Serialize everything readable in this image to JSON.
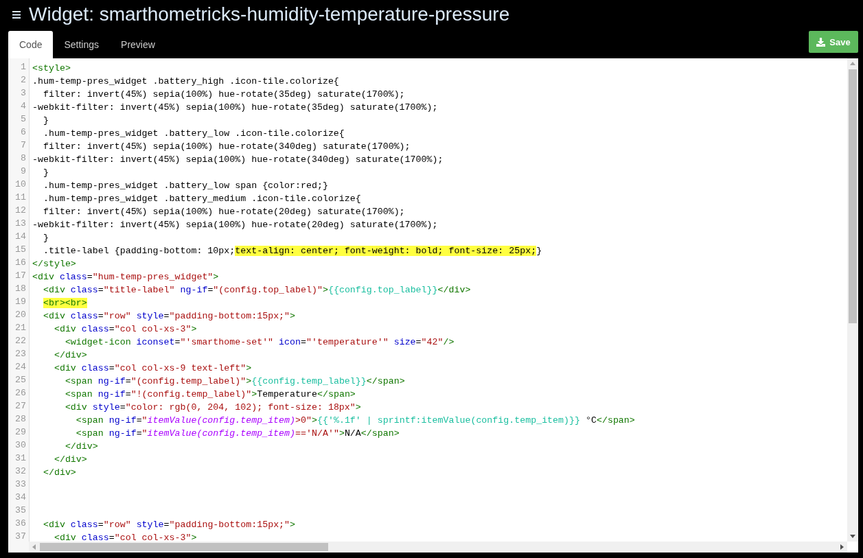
{
  "header": {
    "title": "Widget: smarthometricks-humidity-temperature-pressure"
  },
  "tabs": [
    {
      "label": "Code",
      "selected": true
    },
    {
      "label": "Settings",
      "selected": false
    },
    {
      "label": "Preview",
      "selected": false
    }
  ],
  "save_button": {
    "label": "Save"
  },
  "editor": {
    "lines": [
      {
        "number": "1",
        "tokens": [
          {
            "kind": "tag",
            "text": "<style>"
          }
        ]
      },
      {
        "number": "2",
        "tokens": [
          {
            "kind": "text",
            "text": ".hum-temp-pres_widget .battery_high .icon-tile.colorize{"
          }
        ]
      },
      {
        "number": "3",
        "tokens": [
          {
            "kind": "text",
            "text": "  filter: invert(45%) sepia(100%) hue-rotate(35deg) saturate(1700%);"
          }
        ]
      },
      {
        "number": "4",
        "tokens": [
          {
            "kind": "text",
            "text": "-webkit-filter: invert(45%) sepia(100%) hue-rotate(35deg) saturate(1700%);"
          }
        ]
      },
      {
        "number": "5",
        "tokens": [
          {
            "kind": "text",
            "text": "  }"
          }
        ]
      },
      {
        "number": "6",
        "tokens": [
          {
            "kind": "text",
            "text": "  .hum-temp-pres_widget .battery_low .icon-tile.colorize{"
          }
        ]
      },
      {
        "number": "7",
        "tokens": [
          {
            "kind": "text",
            "text": "  filter: invert(45%) sepia(100%) hue-rotate(340deg) saturate(1700%);"
          }
        ]
      },
      {
        "number": "8",
        "tokens": [
          {
            "kind": "text",
            "text": "-webkit-filter: invert(45%) sepia(100%) hue-rotate(340deg) saturate(1700%);"
          }
        ]
      },
      {
        "number": "9",
        "tokens": [
          {
            "kind": "text",
            "text": "  }"
          }
        ]
      },
      {
        "number": "10",
        "tokens": [
          {
            "kind": "text",
            "text": "  .hum-temp-pres_widget .battery_low span {color:red;}"
          }
        ]
      },
      {
        "number": "11",
        "tokens": [
          {
            "kind": "text",
            "text": "  .hum-temp-pres_widget .battery_medium .icon-tile.colorize{"
          }
        ]
      },
      {
        "number": "12",
        "tokens": [
          {
            "kind": "text",
            "text": "  filter: invert(45%) sepia(100%) hue-rotate(20deg) saturate(1700%);"
          }
        ]
      },
      {
        "number": "13",
        "tokens": [
          {
            "kind": "text",
            "text": "-webkit-filter: invert(45%) sepia(100%) hue-rotate(20deg) saturate(1700%);"
          }
        ]
      },
      {
        "number": "14",
        "tokens": [
          {
            "kind": "text",
            "text": "  }"
          }
        ]
      },
      {
        "number": "15",
        "tokens": [
          {
            "kind": "text",
            "text": "  .title-label {padding-bottom: 10px;"
          },
          {
            "kind": "highlight",
            "text": "text-align: center; font-weight: bold; font-size: 25px;"
          },
          {
            "kind": "text",
            "text": "}"
          }
        ]
      },
      {
        "number": "16",
        "tokens": [
          {
            "kind": "tag",
            "text": "</style>"
          }
        ]
      },
      {
        "number": "17",
        "tokens": [
          {
            "kind": "tag",
            "text": "<div "
          },
          {
            "kind": "attr",
            "text": "class"
          },
          {
            "kind": "text",
            "text": "="
          },
          {
            "kind": "string",
            "text": "\"hum-temp-pres_widget\""
          },
          {
            "kind": "tag",
            "text": ">"
          }
        ]
      },
      {
        "number": "18",
        "tokens": [
          {
            "kind": "tag",
            "text": "  <div "
          },
          {
            "kind": "attr",
            "text": "class"
          },
          {
            "kind": "text",
            "text": "="
          },
          {
            "kind": "string",
            "text": "\"title-label\" "
          },
          {
            "kind": "attr",
            "text": "ng-if"
          },
          {
            "kind": "text",
            "text": "="
          },
          {
            "kind": "string",
            "text": "\"(config.top_label)\""
          },
          {
            "kind": "tag",
            "text": ">"
          },
          {
            "kind": "expr",
            "text": "{{config.top_label}}"
          },
          {
            "kind": "tag",
            "text": "</div>"
          }
        ]
      },
      {
        "number": "19",
        "tokens": [
          {
            "kind": "tag-highlight",
            "text": "<br><br>"
          }
        ]
      },
      {
        "number": "20",
        "tokens": [
          {
            "kind": "tag",
            "text": "  <div "
          },
          {
            "kind": "attr",
            "text": "class"
          },
          {
            "kind": "text",
            "text": "="
          },
          {
            "kind": "string",
            "text": "\"row\" "
          },
          {
            "kind": "attr",
            "text": "style"
          },
          {
            "kind": "text",
            "text": "="
          },
          {
            "kind": "string",
            "text": "\"padding-bottom:15px;\""
          },
          {
            "kind": "tag",
            "text": ">"
          }
        ]
      },
      {
        "number": "21",
        "tokens": [
          {
            "kind": "tag",
            "text": "    <div "
          },
          {
            "kind": "attr",
            "text": "class"
          },
          {
            "kind": "text",
            "text": "="
          },
          {
            "kind": "string",
            "text": "\"col col-xs-3\""
          },
          {
            "kind": "tag",
            "text": ">"
          }
        ]
      },
      {
        "number": "22",
        "tokens": [
          {
            "kind": "tag",
            "text": "      <widget-icon "
          },
          {
            "kind": "attr",
            "text": "iconset"
          },
          {
            "kind": "text",
            "text": "="
          },
          {
            "kind": "string",
            "text": "\"'smarthome-set'\" "
          },
          {
            "kind": "attr",
            "text": "icon"
          },
          {
            "kind": "text",
            "text": "="
          },
          {
            "kind": "string",
            "text": "\"'temperature'\" "
          },
          {
            "kind": "attr",
            "text": "size"
          },
          {
            "kind": "text",
            "text": "="
          },
          {
            "kind": "string",
            "text": "\"42\""
          },
          {
            "kind": "tag",
            "text": "/>"
          }
        ]
      },
      {
        "number": "23",
        "tokens": [
          {
            "kind": "tag",
            "text": "    </div>"
          }
        ]
      },
      {
        "number": "24",
        "tokens": [
          {
            "kind": "tag",
            "text": "    <div "
          },
          {
            "kind": "attr",
            "text": "class"
          },
          {
            "kind": "text",
            "text": "="
          },
          {
            "kind": "string",
            "text": "\"col col-xs-9 text-left\""
          },
          {
            "kind": "tag",
            "text": ">"
          }
        ]
      },
      {
        "number": "25",
        "tokens": [
          {
            "kind": "tag",
            "text": "      <span "
          },
          {
            "kind": "attr",
            "text": "ng-if"
          },
          {
            "kind": "text",
            "text": "="
          },
          {
            "kind": "string",
            "text": "\"(config.temp_label)\""
          },
          {
            "kind": "tag",
            "text": ">"
          },
          {
            "kind": "expr",
            "text": "{{config.temp_label}}"
          },
          {
            "kind": "tag",
            "text": "</span>"
          }
        ]
      },
      {
        "number": "26",
        "tokens": [
          {
            "kind": "tag",
            "text": "      <span "
          },
          {
            "kind": "attr",
            "text": "ng-if"
          },
          {
            "kind": "text",
            "text": "="
          },
          {
            "kind": "string",
            "text": "\"!(config.temp_label)\""
          },
          {
            "kind": "tag",
            "text": ">"
          },
          {
            "kind": "text",
            "text": "Temperature"
          },
          {
            "kind": "tag",
            "text": "</span>"
          }
        ]
      },
      {
        "number": "27",
        "tokens": [
          {
            "kind": "tag",
            "text": "      <div "
          },
          {
            "kind": "attr",
            "text": "style"
          },
          {
            "kind": "text",
            "text": "="
          },
          {
            "kind": "string",
            "text": "\"color: rgb(0, 204, 102); font-size: 18px\""
          },
          {
            "kind": "tag",
            "text": ">"
          }
        ]
      },
      {
        "number": "28",
        "tokens": [
          {
            "kind": "tag",
            "text": "        <span "
          },
          {
            "kind": "attr",
            "text": "ng-if"
          },
          {
            "kind": "text",
            "text": "="
          },
          {
            "kind": "string",
            "text": "\""
          },
          {
            "kind": "script",
            "text": "itemValue(config.temp_item)"
          },
          {
            "kind": "string",
            "text": ">0\""
          },
          {
            "kind": "tag",
            "text": ">"
          },
          {
            "kind": "expr",
            "text": "{{'%.1f' | sprintf:itemValue(config.temp_item)}}"
          },
          {
            "kind": "text",
            "text": " °C"
          },
          {
            "kind": "tag",
            "text": "</span>"
          }
        ]
      },
      {
        "number": "29",
        "tokens": [
          {
            "kind": "tag",
            "text": "        <span "
          },
          {
            "kind": "attr",
            "text": "ng-if"
          },
          {
            "kind": "text",
            "text": "="
          },
          {
            "kind": "string",
            "text": "\""
          },
          {
            "kind": "script",
            "text": "itemValue(config.temp_item)"
          },
          {
            "kind": "string",
            "text": "=='N/A'\""
          },
          {
            "kind": "tag",
            "text": ">"
          },
          {
            "kind": "text",
            "text": "N/A"
          },
          {
            "kind": "tag",
            "text": "</span>"
          }
        ]
      },
      {
        "number": "30",
        "tokens": [
          {
            "kind": "tag",
            "text": "      </div>"
          }
        ]
      },
      {
        "number": "31",
        "tokens": [
          {
            "kind": "tag",
            "text": "    </div>"
          }
        ]
      },
      {
        "number": "32",
        "tokens": [
          {
            "kind": "tag",
            "text": "  </div>"
          }
        ]
      },
      {
        "number": "33"
      },
      {
        "number": "34"
      },
      {
        "number": "35"
      },
      {
        "number": "36",
        "tokens": [
          {
            "kind": "tag",
            "text": "  <div "
          },
          {
            "kind": "attr",
            "text": "class"
          },
          {
            "kind": "text",
            "text": "="
          },
          {
            "kind": "string",
            "text": "\"row\" "
          },
          {
            "kind": "attr",
            "text": "style"
          },
          {
            "kind": "text",
            "text": "="
          },
          {
            "kind": "string",
            "text": "\"padding-bottom:15px;\""
          },
          {
            "kind": "tag",
            "text": ">"
          }
        ]
      },
      {
        "number": "37",
        "tokens": [
          {
            "kind": "tag",
            "text": "    <div "
          },
          {
            "kind": "attr",
            "text": "class"
          },
          {
            "kind": "text",
            "text": "="
          },
          {
            "kind": "string",
            "text": "\"col col-xs-3\""
          },
          {
            "kind": "tag",
            "text": ">"
          }
        ]
      }
    ]
  }
}
